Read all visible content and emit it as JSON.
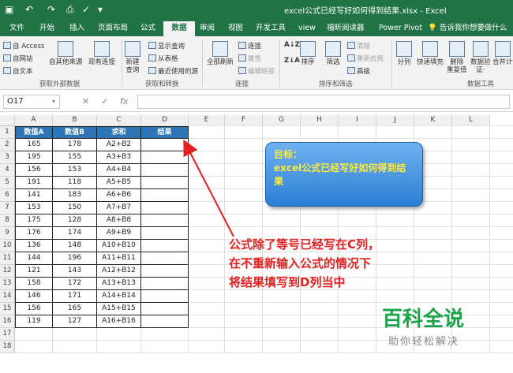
{
  "window": {
    "title": "excel公式已经写好如何得到结果.xlsx - Excel",
    "quick_access": [
      "save-icon",
      "undo-icon",
      "redo-icon",
      "print-preview-icon",
      "spelling-icon",
      "customize-icon"
    ]
  },
  "tabs": [
    "文件",
    "开始",
    "插入",
    "页面布局",
    "公式",
    "数据",
    "审阅",
    "视图",
    "开发工具",
    "view",
    "福昕阅读器",
    "Power Pivot",
    "告诉我你想要做什么"
  ],
  "active_tab": "数据",
  "ribbon": {
    "get_external": {
      "access": "自 Access",
      "web": "自网站",
      "text": "自文本",
      "other": "自其他来源",
      "existing": "现有连接",
      "group": "获取外部数据"
    },
    "get_transform": {
      "new_query": "新建\n查询",
      "show_queries": "显示查询",
      "from_table": "从表格",
      "recent_sources": "最近使用的源",
      "group": "获取和转换"
    },
    "connections": {
      "refresh_all": "全部刷新",
      "connections": "连接",
      "properties": "属性",
      "edit_links": "编辑链接",
      "group": "连接"
    },
    "sort_filter": {
      "az": "A↓Z",
      "za": "Z↓A",
      "sort": "排序",
      "filter": "筛选",
      "clear": "清除",
      "reapply": "重新应用",
      "advanced": "高级",
      "group": "排序和筛选"
    },
    "data_tools": {
      "text_to_columns": "分列",
      "flash_fill": "快速填充",
      "remove_duplicates": "删除\n重复值",
      "validation": "数据验\n证·",
      "consolidate": "合并计",
      "group": "数据工具"
    }
  },
  "formula_bar": {
    "name_box": "O17",
    "cancel": "✕",
    "enter": "✓",
    "fx": "fx",
    "value": ""
  },
  "sheet": {
    "columns": [
      "A",
      "B",
      "C",
      "D",
      "E",
      "F",
      "G",
      "H",
      "I",
      "J",
      "K",
      "L"
    ],
    "headers": [
      "数值A",
      "数值B",
      "求和",
      "结果"
    ],
    "rows": [
      [
        "165",
        "178",
        "A2+B2",
        ""
      ],
      [
        "195",
        "155",
        "A3+B3",
        ""
      ],
      [
        "156",
        "153",
        "A4+B4",
        ""
      ],
      [
        "191",
        "118",
        "A5+B5",
        ""
      ],
      [
        "141",
        "183",
        "A6+B6",
        ""
      ],
      [
        "153",
        "150",
        "A7+B7",
        ""
      ],
      [
        "175",
        "128",
        "A8+B8",
        ""
      ],
      [
        "176",
        "174",
        "A9+B9",
        ""
      ],
      [
        "136",
        "148",
        "A10+B10",
        ""
      ],
      [
        "144",
        "196",
        "A11+B11",
        ""
      ],
      [
        "121",
        "143",
        "A12+B12",
        ""
      ],
      [
        "158",
        "172",
        "A13+B13",
        ""
      ],
      [
        "146",
        "171",
        "A14+B14",
        ""
      ],
      [
        "156",
        "165",
        "A15+B15",
        ""
      ],
      [
        "119",
        "127",
        "A16+B16",
        ""
      ]
    ],
    "row_numbers": [
      "1",
      "2",
      "3",
      "4",
      "5",
      "6",
      "7",
      "8",
      "9",
      "10",
      "11",
      "12",
      "13",
      "14",
      "15",
      "16",
      "17",
      "18"
    ]
  },
  "overlay": {
    "goal_label": "目标：",
    "goal_text": "excel公式已经写好如何得到结果",
    "note_lines": [
      "公式除了等号已经写在C列，",
      "在不重新输入公式的情况下",
      "将结果填写到D列当中"
    ],
    "watermark_title": "百科全说",
    "watermark_sub": "助你轻松解决"
  },
  "colors": {
    "excel_green": "#217346",
    "header_blue": "#2e75b6",
    "note_red": "#e22020",
    "watermark_green": "#1aa34a",
    "goal_yellow": "#ffeb3b"
  }
}
